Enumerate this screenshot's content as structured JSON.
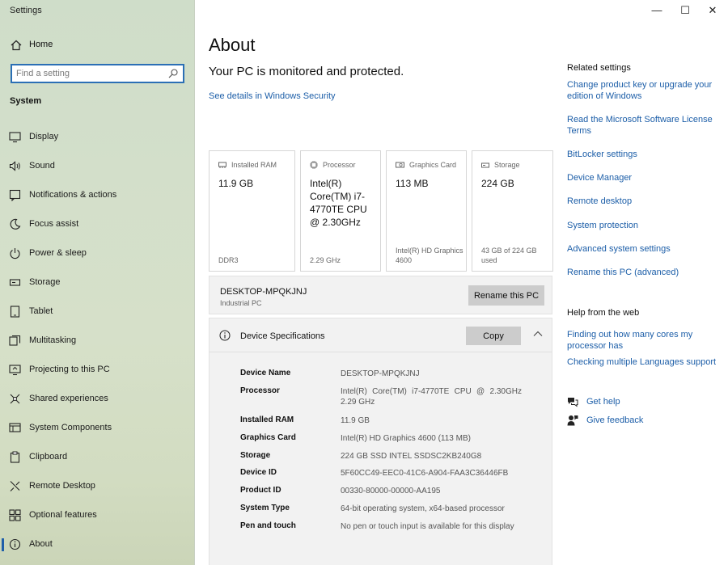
{
  "window": {
    "title": "Settings",
    "minimize_glyph": "—",
    "maximize_glyph": "☐",
    "close_glyph": "✕"
  },
  "sidebar": {
    "home_label": "Home",
    "search_placeholder": "Find a setting",
    "section": "System",
    "items": [
      {
        "label": "Display",
        "icon": "display-icon"
      },
      {
        "label": "Sound",
        "icon": "speaker-icon"
      },
      {
        "label": "Notifications & actions",
        "icon": "notification-icon"
      },
      {
        "label": "Focus assist",
        "icon": "moon-icon"
      },
      {
        "label": "Power & sleep",
        "icon": "power-icon"
      },
      {
        "label": "Storage",
        "icon": "storage-icon"
      },
      {
        "label": "Tablet",
        "icon": "tablet-icon"
      },
      {
        "label": "Multitasking",
        "icon": "multitasking-icon"
      },
      {
        "label": "Projecting to this PC",
        "icon": "project-icon"
      },
      {
        "label": "Shared experiences",
        "icon": "shared-icon"
      },
      {
        "label": "System Components",
        "icon": "components-icon"
      },
      {
        "label": "Clipboard",
        "icon": "clipboard-icon"
      },
      {
        "label": "Remote Desktop",
        "icon": "remote-desktop-icon"
      },
      {
        "label": "Optional features",
        "icon": "features-icon"
      },
      {
        "label": "About",
        "icon": "info-icon",
        "active": true
      }
    ]
  },
  "main": {
    "title": "About",
    "protection_status": "Your PC is monitored and protected.",
    "security_link": "See details in Windows Security",
    "cards": [
      {
        "label": "Installed RAM",
        "value": "11.9 GB",
        "sub": "DDR3",
        "icon": "ram-icon"
      },
      {
        "label": "Processor",
        "value": "Intel(R) Core(TM) i7-4770TE CPU @ 2.30GHz",
        "sub": "2.29 GHz",
        "icon": "processor-icon"
      },
      {
        "label": "Graphics Card",
        "value": "113 MB",
        "sub": "Intel(R) HD Graphics 4600",
        "icon": "graphics-card-icon"
      },
      {
        "label": "Storage",
        "value": "224 GB",
        "sub": "43 GB of 224 GB used",
        "icon": "storage-drive-icon"
      }
    ],
    "pc_name": "DESKTOP-MPQKJNJ",
    "pc_type": "Industrial PC",
    "rename_button": "Rename this PC",
    "device_specs": {
      "title": "Device Specifications",
      "copy_button": "Copy",
      "rows": [
        {
          "key": "Device Name",
          "value": "DESKTOP-MPQKJNJ"
        },
        {
          "key": "Processor",
          "value": "Intel(R) Core(TM) i7-4770TE CPU @ 2.30GHz 2.29 GHz"
        },
        {
          "key": "Installed RAM",
          "value": "11.9 GB"
        },
        {
          "key": "Graphics Card",
          "value": "Intel(R) HD Graphics 4600 (113 MB)"
        },
        {
          "key": "Storage",
          "value": "224 GB SSD INTEL SSDSC2KB240G8"
        },
        {
          "key": "Device ID",
          "value": "5F60CC49-EEC0-41C6-A904-FAA3C36446FB"
        },
        {
          "key": "Product ID",
          "value": "00330-80000-00000-AA195"
        },
        {
          "key": "System Type",
          "value": "64-bit operating system, x64-based processor"
        },
        {
          "key": "Pen and touch",
          "value": "No pen or touch input is available for this display"
        }
      ]
    }
  },
  "related": {
    "title": "Related settings",
    "links": [
      "Change product key or upgrade your edition of Windows",
      "Read the Microsoft Software License Terms",
      "BitLocker settings",
      "Device Manager",
      "Remote desktop",
      "System protection",
      "Advanced system settings",
      "Rename this PC (advanced)"
    ]
  },
  "help": {
    "title": "Help from the web",
    "links": [
      "Finding out how many cores my processor has",
      "Checking multiple Languages support"
    ],
    "get_help": "Get help",
    "give_feedback": "Give feedback"
  },
  "colors": {
    "accent": "#1c5ea8",
    "sidebar_bg": "#d3dfca",
    "button_bg": "#cccccc",
    "panel_bg": "#f2f2f2"
  }
}
